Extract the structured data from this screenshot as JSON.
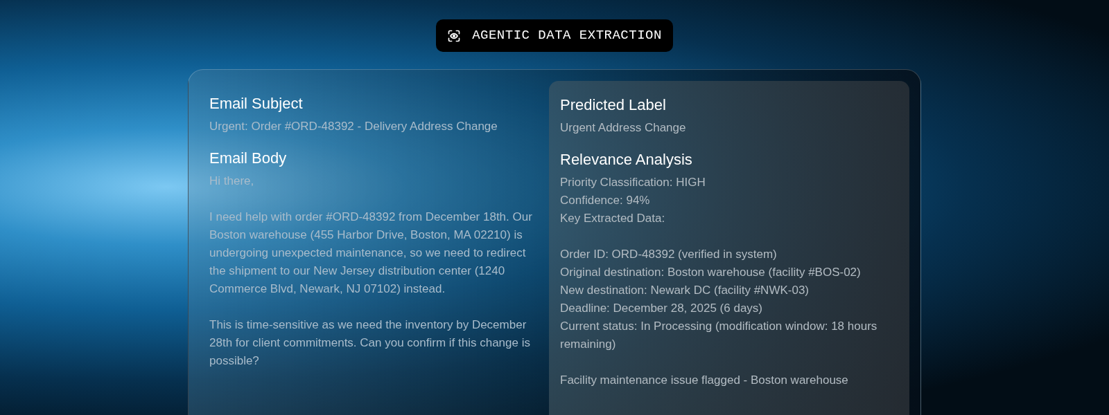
{
  "badge": {
    "label": "AGENTIC DATA EXTRACTION"
  },
  "email": {
    "subject_heading": "Email Subject",
    "subject": "Urgent: Order #ORD-48392 - Delivery Address Change",
    "body_heading": "Email Body",
    "body": [
      "Hi there,",
      "I need help with order #ORD-48392 from December 18th. Our Boston warehouse (455 Harbor Drive, Boston, MA 02210) is undergoing unexpected maintenance, so we need to redirect the shipment to our New Jersey distribution center (1240 Commerce Blvd, Newark, NJ 07102) instead.",
      "This is time-sensitive as we need the inventory by December 28th for client commitments. Can you confirm if this change is possible?"
    ]
  },
  "prediction": {
    "label_heading": "Predicted Label",
    "label": "Urgent Address Change",
    "analysis_heading": "Relevance Analysis",
    "analysis": [
      [
        "Priority Classification: HIGH",
        "Confidence: 94%",
        "Key Extracted Data:"
      ],
      [
        "Order ID: ORD-48392 (verified in system)",
        "Original destination: Boston warehouse (facility #BOS-02)",
        "New destination: Newark DC (facility #NWK-03)",
        "Deadline: December 28, 2025 (6 days)",
        "Current status: In Processing (modification window: 18 hours remaining)"
      ],
      [
        "Facility maintenance issue flagged - Boston warehouse"
      ]
    ]
  }
}
